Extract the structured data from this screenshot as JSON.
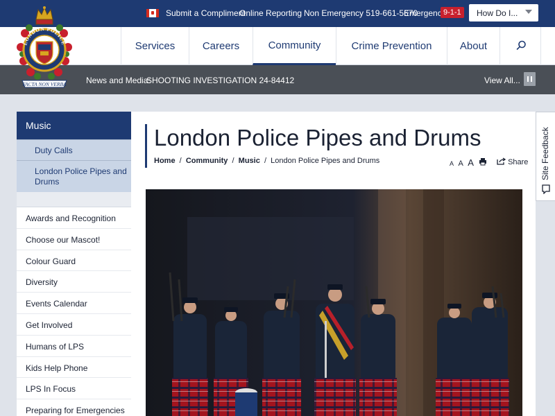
{
  "topbar": {
    "compliment": "Submit a Compliment",
    "online_reporting": "Online Reporting",
    "non_emergency": "Non Emergency 519-661-5670",
    "emergency_label": "Emergency",
    "emergency_number": "9-1-1",
    "how_do_i": "How Do I..."
  },
  "logo": {
    "top_text": "LONDON POLICE",
    "motto": "FACTA NON VERBA"
  },
  "nav": {
    "items": [
      "Services",
      "Careers",
      "Community",
      "Crime Prevention",
      "About"
    ],
    "active": "Community",
    "search_icon": "search-icon"
  },
  "news": {
    "label": "News and Media:",
    "item": "SHOOTING INVESTIGATION 24-84412",
    "view_all": "View All..."
  },
  "sidebar": {
    "heading": "Music",
    "sub_items": [
      "Duty Calls",
      "London Police Pipes and Drums"
    ],
    "items": [
      "Awards and Recognition",
      "Choose our Mascot!",
      "Colour Guard",
      "Diversity",
      "Events Calendar",
      "Get Involved",
      "Humans of LPS",
      "Kids Help Phone",
      "LPS In Focus",
      "Preparing for Emergencies"
    ]
  },
  "page": {
    "title": "London Police Pipes and Drums",
    "breadcrumb": [
      "Home",
      "Community",
      "Music",
      "London Police Pipes and Drums"
    ],
    "text_sizes": [
      "A",
      "A",
      "A"
    ],
    "share": "Share"
  },
  "feedback": {
    "label": "Site Feedback"
  },
  "colors": {
    "brand_navy": "#1e3a72",
    "news_bar": "#4a4f56",
    "emergency_red": "#c8202d",
    "sub_nav_bg": "#c9d5e6"
  }
}
